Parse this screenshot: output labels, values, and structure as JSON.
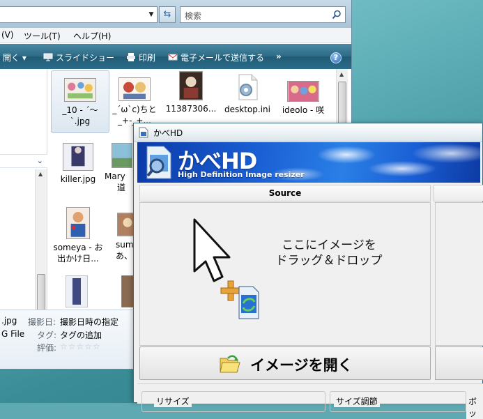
{
  "explorer": {
    "search_placeholder": "検索",
    "menu": [
      "(V)",
      "ツール(T)",
      "ヘルプ(H)"
    ],
    "toolbar": [
      "開く",
      "スライドショー",
      "印刷",
      "電子メールで送信する"
    ],
    "toolbar_more": "»",
    "files": [
      {
        "name_line1": "_10 - ´～",
        "name_line2": "`.jpg",
        "selected": true
      },
      {
        "name_line1": "_´ω`c)ちと",
        "name_line2": "_+-_+..."
      },
      {
        "name_line1": "11387306...",
        "name_line2": ""
      },
      {
        "name_line1": "desktop.ini",
        "name_line2": ""
      },
      {
        "name_line1": "ideolo - 咲",
        "name_line2": ""
      },
      {
        "name_line1": "killer.jpg",
        "name_line2": ""
      },
      {
        "name_line1": "Mary",
        "name_line2": "道"
      },
      {
        "name_line1": "someya - お",
        "name_line2": "出かけ日..."
      },
      {
        "name_line1": "sum",
        "name_line2": "あ、"
      }
    ],
    "details": {
      "filename": ".jpg",
      "filetype": "G File",
      "date_label": "撮影日:",
      "date_value": "撮影日時の指定",
      "tag_label": "タグ:",
      "tag_value": "タグの追加",
      "rating_label": "評価:",
      "stars": "☆☆☆☆☆"
    }
  },
  "kabehd": {
    "window_title": "かべHD",
    "logo_title": "かべHD",
    "logo_subtitle": "High Definition Image resizer",
    "source_header": "Source",
    "drop_line1": "ここにイメージを",
    "drop_line2": "ドラッグ＆ドロップ",
    "open_button": "イメージを開く",
    "group_resize": "リサイズ",
    "group_adjust": "サイズ調節",
    "group_right": "ボッ"
  },
  "colors": {
    "toolbar": "#2d6a85",
    "banner_blue": "#1a5fd4",
    "desktop": "#5fb0b8"
  }
}
